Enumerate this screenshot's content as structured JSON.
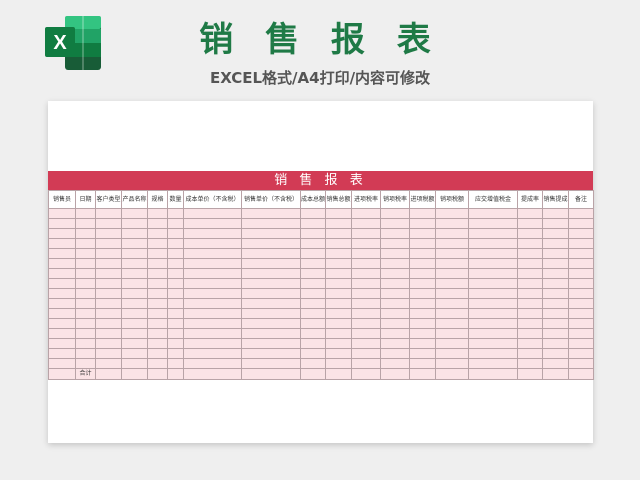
{
  "banner": {
    "title": "销 售 报 表",
    "subtitle": "EXCEL格式/A4打印/内容可修改"
  },
  "logo": {
    "icon": "excel-icon",
    "letter": "X",
    "colors": {
      "dark": "#185c37",
      "mid": "#21a366",
      "light": "#33c481",
      "darkest": "#107c41"
    }
  },
  "sheet": {
    "title": "销 售 报 表",
    "accent_color": "#d23b55",
    "cell_color": "#fbe3e6",
    "columns": [
      "销售员",
      "日期",
      "客户类型",
      "产品名称",
      "规格",
      "数量",
      "成本单价（不含税）",
      "销售单价（不含税）",
      "成本总额",
      "销售总额",
      "进项税率",
      "销项税率",
      "进项税额",
      "销项税额",
      "应交增值税金",
      "提成率",
      "销售提成",
      "备注"
    ],
    "total_label": "合计"
  }
}
